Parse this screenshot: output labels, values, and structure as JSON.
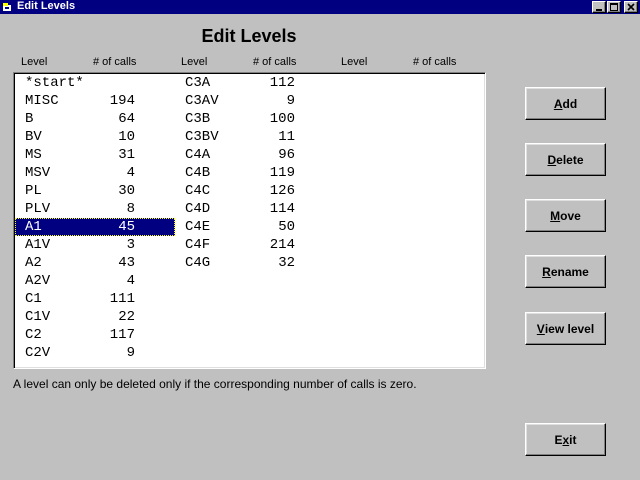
{
  "window": {
    "title": "Edit Levels"
  },
  "heading": "Edit Levels",
  "columns": {
    "level1": "Level",
    "calls1": "# of calls",
    "level2": "Level",
    "calls2": "# of calls",
    "level3": "Level",
    "calls3": "# of calls"
  },
  "list": {
    "col1": [
      {
        "level": "*start*",
        "calls": ""
      },
      {
        "level": "MISC",
        "calls": "194"
      },
      {
        "level": "B",
        "calls": "64"
      },
      {
        "level": "BV",
        "calls": "10"
      },
      {
        "level": "MS",
        "calls": "31"
      },
      {
        "level": "MSV",
        "calls": "4"
      },
      {
        "level": "PL",
        "calls": "30"
      },
      {
        "level": "PLV",
        "calls": "8"
      },
      {
        "level": "A1",
        "calls": "45"
      },
      {
        "level": "A1V",
        "calls": "3"
      },
      {
        "level": "A2",
        "calls": "43"
      },
      {
        "level": "A2V",
        "calls": "4"
      },
      {
        "level": "C1",
        "calls": "111"
      },
      {
        "level": "C1V",
        "calls": "22"
      },
      {
        "level": "C2",
        "calls": "117"
      },
      {
        "level": "C2V",
        "calls": "9"
      }
    ],
    "col2": [
      {
        "level": "C3A",
        "calls": "112"
      },
      {
        "level": "C3AV",
        "calls": "9"
      },
      {
        "level": "C3B",
        "calls": "100"
      },
      {
        "level": "C3BV",
        "calls": "11"
      },
      {
        "level": "C4A",
        "calls": "96"
      },
      {
        "level": "C4B",
        "calls": "119"
      },
      {
        "level": "C4C",
        "calls": "126"
      },
      {
        "level": "C4D",
        "calls": "114"
      },
      {
        "level": "C4E",
        "calls": "50"
      },
      {
        "level": "C4F",
        "calls": "214"
      },
      {
        "level": "C4G",
        "calls": "32"
      }
    ],
    "selected": "A1"
  },
  "note": "A level can only be deleted only if the corresponding number of calls is zero.",
  "buttons": {
    "add": {
      "mn": "A",
      "rest": "dd"
    },
    "delete": {
      "mn": "D",
      "rest": "elete"
    },
    "move": {
      "mn": "M",
      "rest": "ove"
    },
    "rename": {
      "mn": "R",
      "rest": "ename"
    },
    "view": {
      "mn": "V",
      "rest": "iew level"
    },
    "exit": {
      "pre": "E",
      "mn": "x",
      "rest": "it"
    }
  },
  "icons": {
    "app": "app-icon",
    "minimize": "minimize-icon",
    "maximize": "maximize-icon",
    "close": "close-icon"
  },
  "colors": {
    "titlebar": "#000080",
    "selection": "#000080",
    "face": "#c0c0c0"
  }
}
